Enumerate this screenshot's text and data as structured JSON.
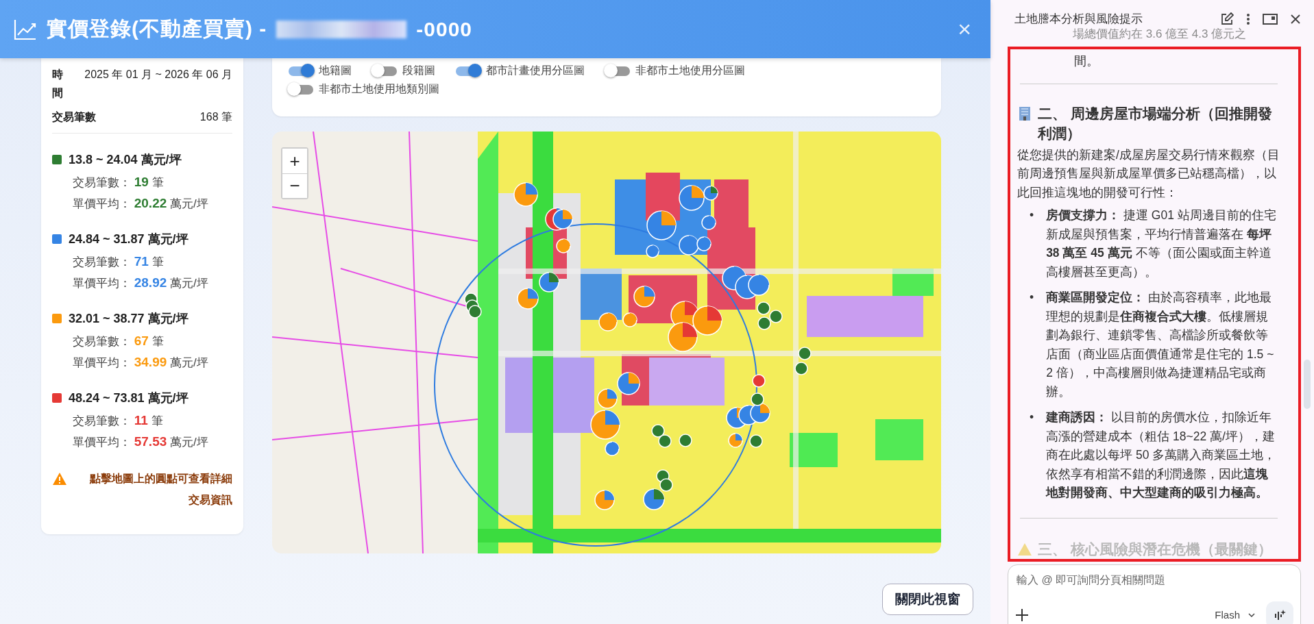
{
  "window": {
    "title": "實價登錄(不動產買賣) -",
    "title_suffix": "-0000",
    "close": "×"
  },
  "summary": {
    "period_label": "時間",
    "period_value": "2025 年 01 月 ~ 2026 年 06 月",
    "count_label": "交易筆數",
    "count_value": "168 筆"
  },
  "legend": [
    {
      "range": "13.8 ~ 24.04 萬元/坪",
      "color": "#2e7d32",
      "count_label": "交易筆數：",
      "count": "19",
      "count_unit": "筆",
      "avg_label": "單價平均：",
      "avg": "20.22",
      "avg_unit": "萬元/坪"
    },
    {
      "range": "24.84 ~ 31.87 萬元/坪",
      "color": "#3584e4",
      "count_label": "交易筆數：",
      "count": "71",
      "count_unit": "筆",
      "avg_label": "單價平均：",
      "avg": "28.92",
      "avg_unit": "萬元/坪"
    },
    {
      "range": "32.01 ~ 38.77 萬元/坪",
      "color": "#fb9a0e",
      "count_label": "交易筆數：",
      "count": "67",
      "count_unit": "筆",
      "avg_label": "單價平均：",
      "avg": "34.99",
      "avg_unit": "萬元/坪"
    },
    {
      "range": "48.24 ~ 73.81 萬元/坪",
      "color": "#e53935",
      "count_label": "交易筆數：",
      "count": "11",
      "count_unit": "筆",
      "avg_label": "單價平均：",
      "avg": "57.53",
      "avg_unit": "萬元/坪"
    }
  ],
  "hint": "點擊地圖上的圓點可查看詳細交易資訊",
  "layers": [
    {
      "label": "地籍圖",
      "on": true
    },
    {
      "label": "段籍圖",
      "on": false
    },
    {
      "label": "都市計畫使用分區圖",
      "on": true
    },
    {
      "label": "非都市土地使用分區圖",
      "on": false
    },
    {
      "label": "非都市土地使用地類別圖",
      "on": false
    }
  ],
  "map": {
    "zoom_in": "+",
    "zoom_out": "−"
  },
  "close_button": "關閉此視窗",
  "assistant": {
    "title": "土地謄本分析與風險提示",
    "faded_line": "場總價值約在 3.6 億至 4.3 億元之",
    "tail": "間。",
    "section_heading": "二、 周邊房屋市場端分析（回推開發利潤）",
    "intro": "從您提供的新建案/成屋房屋交易行情來觀察（目前周邊預售屋與新成屋單價多已站穩高檔），以此回推這塊地的開發可行性：",
    "bullets": [
      "**房價支撐力：** 捷運 G01 站周邊目前的住宅新成屋與預售案，平均行情普遍落在 **每坪 38 萬至 45 萬元** 不等（面公園或面主幹道高樓層甚至更高）。",
      "**商業區開發定位：** 由於高容積率，此地最理想的規劃是**住商複合式大樓**。低樓層規劃為銀行、連鎖零售、高檔診所或餐飲等店面（商业區店面價值通常是住宅的 1.5 ~ 2 倍），中高樓層則做為捷運精品宅或商辦。",
      "**建商誘因：** 以目前的房價水位，扣除近年高漲的營建成本（粗估 18~22 萬/坪），建商在此處以每坪 50 多萬購入商業區土地，依然享有相當不錯的利潤邊際，因此**這塊地對開發商、中大型建商的吸引力極高。**"
    ],
    "bullet_mark": "•",
    "next_heading": "三、 核心風險與潛在危機（最關鍵）",
    "input_placeholder": "輸入 @ 即可詢問分頁相關問題",
    "model": "Flash"
  }
}
